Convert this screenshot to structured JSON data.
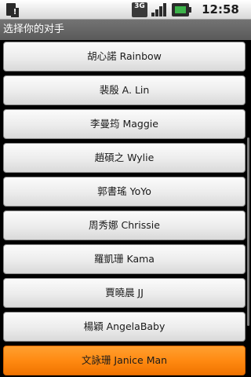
{
  "status_bar": {
    "network_label": "3G",
    "alert_glyph": "!",
    "time": "12:58 PM",
    "icons": [
      "sim-alert-icon",
      "3g-icon",
      "signal-icon",
      "battery-icon"
    ]
  },
  "title": "选择你的对手",
  "opponents": [
    {
      "label": "胡心諾 Rainbow"
    },
    {
      "label": "裴殷 A. Lin"
    },
    {
      "label": "李曼筠 Maggie"
    },
    {
      "label": "趙碩之 Wylie"
    },
    {
      "label": "郭書瑤 YoYo"
    },
    {
      "label": "周秀娜 Chrissie"
    },
    {
      "label": "羅凱珊 Kama"
    },
    {
      "label": "賈曉晨 JJ"
    },
    {
      "label": "楊穎 AngelaBaby"
    },
    {
      "label": "文詠珊 Janice Man"
    }
  ],
  "selected_index": 9,
  "colors": {
    "selected": "#ff8a12",
    "button": "#ececec",
    "title_bar": "#666666"
  }
}
